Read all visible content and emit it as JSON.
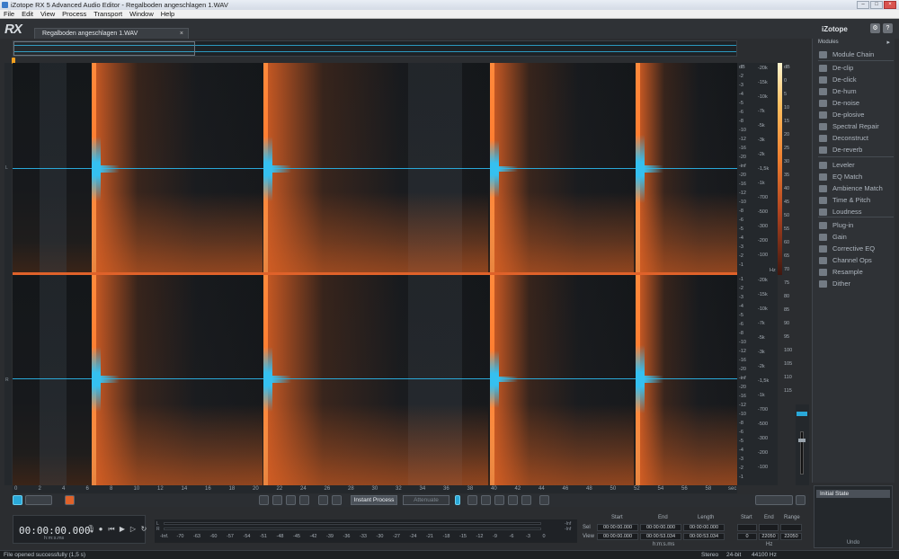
{
  "window": {
    "title": "iZotope RX 5 Advanced Audio Editor - Regalboden angeschlagen 1.WAV"
  },
  "menu": [
    "File",
    "Edit",
    "View",
    "Process",
    "Transport",
    "Window",
    "Help"
  ],
  "header": {
    "logo": "RX",
    "file_tab": "Regalboden angeschlagen 1.WAV",
    "tab_close": "×",
    "brand": "iZotope",
    "help_btn": "?",
    "settings_btn": "⚙"
  },
  "ruler": {
    "ticks": [
      "0",
      "2",
      "4",
      "6",
      "8",
      "10",
      "12",
      "14",
      "16",
      "18",
      "20",
      "22",
      "24",
      "26",
      "28",
      "30",
      "32",
      "34",
      "36",
      "38",
      "40",
      "42",
      "44",
      "46",
      "48",
      "50",
      "52",
      "54",
      "56",
      "58"
    ],
    "unit": "sec"
  },
  "freq_scale": {
    "ch1": [
      "-20k",
      "-15k",
      "-10k",
      "-7k",
      "-5k",
      "-3k",
      "-2k",
      "-1,5k",
      "-1k",
      "-700",
      "-500",
      "-300",
      "-200",
      "-100"
    ],
    "ch2": [
      "-20k",
      "-15k",
      "-10k",
      "-7k",
      "-5k",
      "-3k",
      "-2k",
      "-1,5k",
      "-1k",
      "-700",
      "-500",
      "-300",
      "-200",
      "-100"
    ],
    "unit": "Hz"
  },
  "db_scale": {
    "ch1": [
      "dB",
      "-2",
      "-3",
      "-4",
      "-5",
      "-6",
      "-8",
      "-10",
      "-12",
      "-16",
      "-20",
      "-inf",
      "-20",
      "-16",
      "-12",
      "-10",
      "-8",
      "-6",
      "-5",
      "-4",
      "-3",
      "-2",
      "-1"
    ],
    "ch2": [
      "-1",
      "-2",
      "-3",
      "-4",
      "-5",
      "-6",
      "-8",
      "-10",
      "-12",
      "-16",
      "-20",
      "-inf",
      "-20",
      "-16",
      "-12",
      "-10",
      "-8",
      "-6",
      "-5",
      "-4",
      "-3",
      "-2",
      "-1"
    ]
  },
  "color_scale": [
    "dB",
    "0",
    "5",
    "10",
    "15",
    "20",
    "25",
    "30",
    "35",
    "40",
    "45",
    "50",
    "55",
    "60",
    "65",
    "70",
    "75",
    "80",
    "85",
    "90",
    "95",
    "100",
    "105",
    "110",
    "115"
  ],
  "modules": {
    "header": "Modules",
    "arrow": "▸",
    "items": [
      {
        "label": "Module Chain",
        "icon": "module-chain-icon"
      },
      {
        "label": "De-clip",
        "icon": "de-clip-icon"
      },
      {
        "label": "De-click",
        "icon": "de-click-icon"
      },
      {
        "label": "De-hum",
        "icon": "de-hum-icon"
      },
      {
        "label": "De-noise",
        "icon": "de-noise-icon"
      },
      {
        "label": "De-plosive",
        "icon": "de-plosive-icon"
      },
      {
        "label": "Spectral Repair",
        "icon": "spectral-repair-icon"
      },
      {
        "label": "Deconstruct",
        "icon": "deconstruct-icon"
      },
      {
        "label": "De-reverb",
        "icon": "de-reverb-icon"
      },
      {
        "label": "Leveler",
        "icon": "leveler-icon"
      },
      {
        "label": "EQ Match",
        "icon": "eq-match-icon"
      },
      {
        "label": "Ambience Match",
        "icon": "ambience-match-icon"
      },
      {
        "label": "Time & Pitch",
        "icon": "time-pitch-icon"
      },
      {
        "label": "Loudness",
        "icon": "loudness-icon"
      },
      {
        "label": "Plug-in",
        "icon": "plug-in-icon"
      },
      {
        "label": "Gain",
        "icon": "gain-icon"
      },
      {
        "label": "Corrective EQ",
        "icon": "corrective-eq-icon"
      },
      {
        "label": "Channel Ops",
        "icon": "channel-ops-icon"
      },
      {
        "label": "Resample",
        "icon": "resample-icon"
      },
      {
        "label": "Dither",
        "icon": "dither-icon"
      }
    ]
  },
  "history": {
    "item": "Initial State",
    "label": "Undo"
  },
  "toolbar": {
    "instant_process": "Instant Process",
    "mode": "Attenuate"
  },
  "transport": {
    "time": "00:00:00.000",
    "format": "h:m:s.ms"
  },
  "meter": {
    "left": "L",
    "right": "R",
    "left_peak": "-Inf",
    "right_peak": "-Inf",
    "ticks": [
      "-Inf.",
      "-70",
      "-63",
      "-60",
      "-57",
      "-54",
      "-51",
      "-48",
      "-45",
      "-42",
      "-39",
      "-36",
      "-33",
      "-30",
      "-27",
      "-24",
      "-21",
      "-18",
      "-15",
      "-12",
      "-9",
      "-6",
      "-3",
      "0"
    ]
  },
  "selection": {
    "headers": [
      "Start",
      "End",
      "Length"
    ],
    "sel_label": "Sel",
    "view_label": "View",
    "sel": [
      "00:00:00.000",
      "00:00:00.000",
      "00:00:00.000"
    ],
    "view": [
      "00:00:00.000",
      "00:00:53.034",
      "00:00:53.034"
    ],
    "format": "h:m:s.ms",
    "freq_headers": [
      "Start",
      "End",
      "Range"
    ],
    "sel_freq": [
      "",
      "",
      ""
    ],
    "view_freq": [
      "0",
      "22050",
      "22050"
    ],
    "freq_unit": "Hz"
  },
  "status": {
    "message": "File opened successfully (1,5 s)",
    "channels": "Stereo",
    "bits": "24-bit",
    "rate": "44100 Hz"
  },
  "colors": {
    "accent": "#2aa8d8",
    "spectrum": "#e0622a"
  }
}
